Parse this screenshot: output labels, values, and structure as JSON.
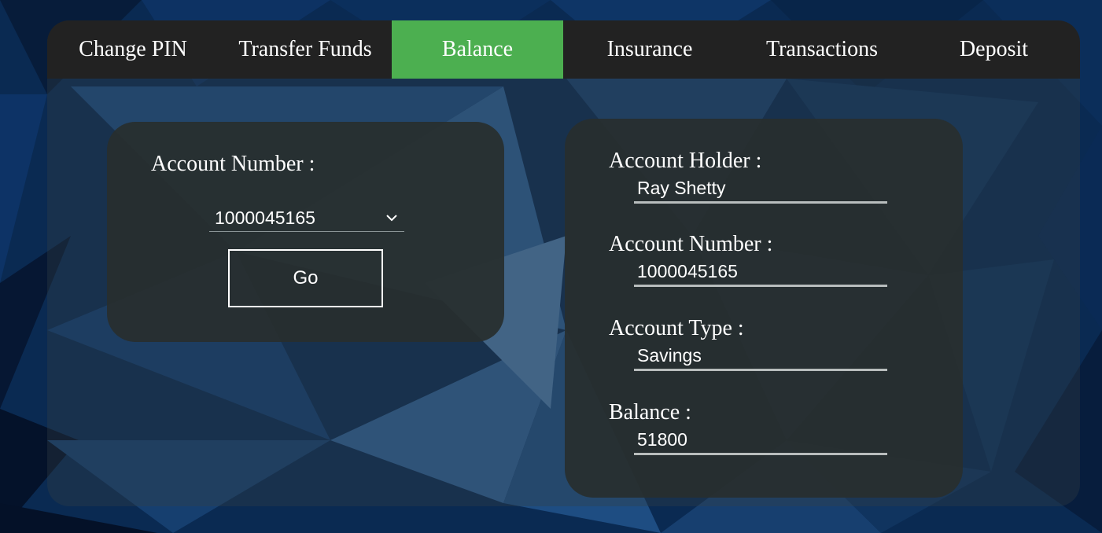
{
  "nav": {
    "tabs": [
      {
        "label": "Change PIN"
      },
      {
        "label": "Transfer Funds"
      },
      {
        "label": "Balance",
        "active": true
      },
      {
        "label": "Insurance"
      },
      {
        "label": "Transactions"
      },
      {
        "label": "Deposit"
      }
    ],
    "active_color": "#4caf50"
  },
  "query": {
    "account_number_label": "Account Number :",
    "selected_account": "1000045165",
    "go_label": "Go"
  },
  "details": {
    "holder_label": "Account Holder :",
    "holder_value": "Ray Shetty",
    "number_label": "Account Number :",
    "number_value": "1000045165",
    "type_label": "Account Type :",
    "type_value": "Savings",
    "balance_label": "Balance :",
    "balance_value": "51800"
  }
}
